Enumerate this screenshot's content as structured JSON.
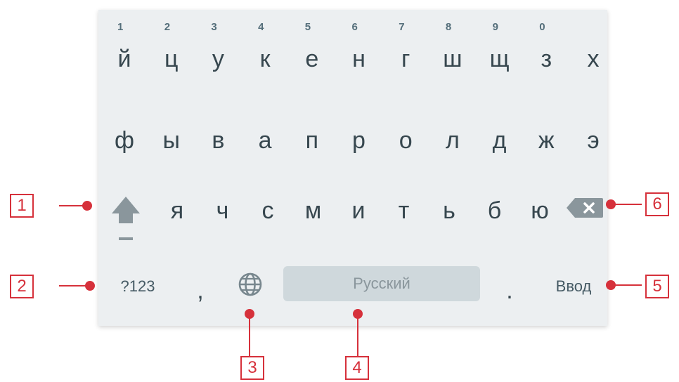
{
  "keyboard": {
    "row1": [
      {
        "char": "й",
        "hint": "1"
      },
      {
        "char": "ц",
        "hint": "2"
      },
      {
        "char": "у",
        "hint": "3"
      },
      {
        "char": "к",
        "hint": "4"
      },
      {
        "char": "е",
        "hint": "5"
      },
      {
        "char": "н",
        "hint": "6"
      },
      {
        "char": "г",
        "hint": "7"
      },
      {
        "char": "ш",
        "hint": "8"
      },
      {
        "char": "щ",
        "hint": "9"
      },
      {
        "char": "з",
        "hint": "0"
      },
      {
        "char": "х",
        "hint": ""
      }
    ],
    "row2": [
      "ф",
      "ы",
      "в",
      "а",
      "п",
      "р",
      "о",
      "л",
      "д",
      "ж",
      "э"
    ],
    "row3": [
      "я",
      "ч",
      "с",
      "м",
      "и",
      "т",
      "ь",
      "б",
      "ю"
    ],
    "symbols_label": "?123",
    "comma": ",",
    "space_label": "Русский",
    "period": ".",
    "enter_label": "Ввод",
    "shift_icon": "shift-icon",
    "globe_icon": "globe-icon",
    "backspace_icon": "backspace-icon"
  },
  "callouts": [
    "1",
    "2",
    "3",
    "4",
    "5",
    "6"
  ],
  "colors": {
    "keyboard_bg": "#eceff1",
    "key_text": "#37474f",
    "space_bar": "#cfd8dc",
    "callout": "#d6313b"
  }
}
